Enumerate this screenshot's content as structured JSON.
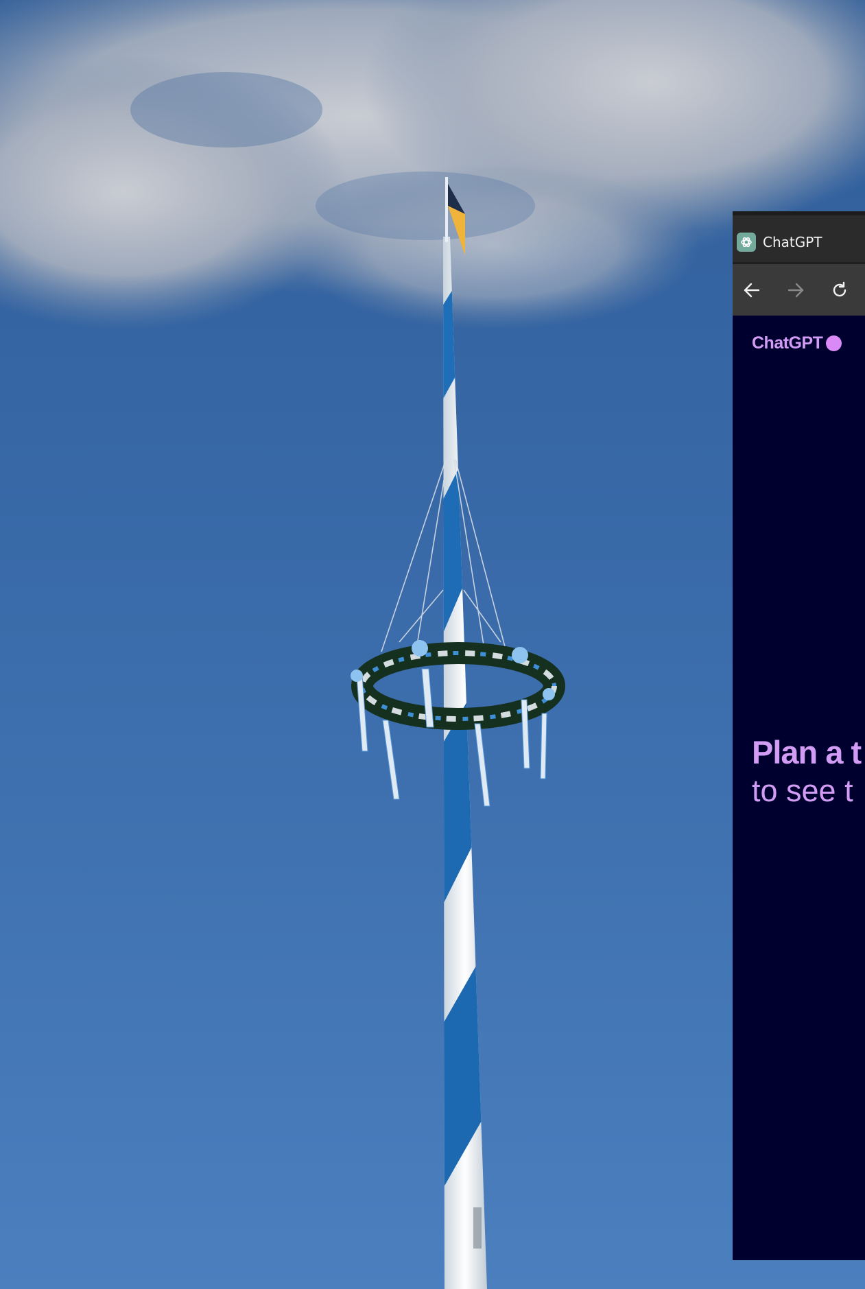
{
  "browser": {
    "tab_title": "ChatGPT",
    "favicon_icon": "openai-logo-icon",
    "nav": {
      "back_icon": "arrow-left-icon",
      "forward_icon": "arrow-right-icon",
      "reload_icon": "reload-icon"
    }
  },
  "page": {
    "brand_name": "ChatGPT",
    "headline_line1": "Plan a t",
    "headline_line2": "to see t"
  },
  "colors": {
    "sky": "#3d6dab",
    "page_background": "#00002e",
    "accent_purple": "#d29cf5",
    "titlebar": "#2b2b2b",
    "navbar": "#3a3a3a"
  }
}
